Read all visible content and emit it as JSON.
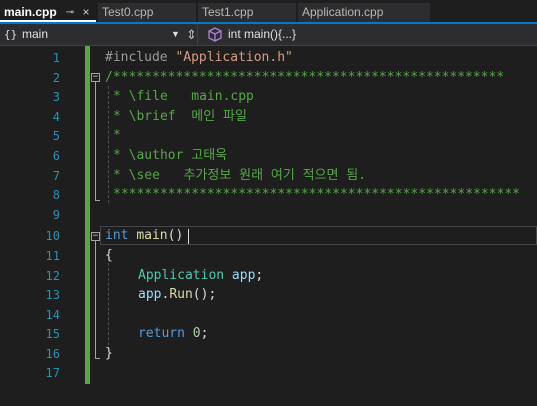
{
  "tabs": [
    {
      "label": "main.cpp",
      "active": true,
      "pin_icon": "⊸",
      "close_icon": "×"
    },
    {
      "label": "Test0.cpp",
      "active": false
    },
    {
      "label": "Test1.cpp",
      "active": false
    },
    {
      "label": "Application.cpp",
      "active": false
    }
  ],
  "navbar": {
    "project_icon": "{}",
    "project": "main",
    "member_icon": "cube",
    "member": "int main(){...}"
  },
  "line_numbers": [
    "1",
    "2",
    "3",
    "4",
    "5",
    "6",
    "7",
    "8",
    "9",
    "10",
    "11",
    "12",
    "13",
    "14",
    "15",
    "16",
    "17"
  ],
  "code": {
    "l1": {
      "directive": "#include ",
      "string": "\"Application.h\""
    },
    "l2": {
      "comment": "/**************************************************"
    },
    "l3": {
      "comment": "* \\file   main.cpp"
    },
    "l4": {
      "comment": "* \\brief  메인 파일"
    },
    "l5": {
      "comment": "*"
    },
    "l6": {
      "comment": "* \\author 고태욱"
    },
    "l7": {
      "comment": "* \\see   추가정보 원래 여기 적으면 됨."
    },
    "l8": {
      "comment": "****************************************************"
    },
    "l10": {
      "kw": "int",
      "fn": "main",
      "paren_open": "(",
      "paren_close": ")"
    },
    "l11": {
      "brace": "{"
    },
    "l12": {
      "type": "Application",
      "var": "app",
      "semi": ";"
    },
    "l13": {
      "var": "app",
      "dot": ".",
      "fn": "Run",
      "parens": "();"
    },
    "l15": {
      "kw": "return",
      "num": "0",
      "semi": ";"
    },
    "l16": {
      "brace": "}"
    }
  },
  "colors": {
    "accent": "#007acc",
    "line_number": "#2b91af",
    "change_bar": "#57a64a",
    "comment": "#57a64a",
    "keyword": "#569cd6",
    "string": "#d69d85",
    "type": "#4ec9b0",
    "function": "#dcdcaa"
  }
}
